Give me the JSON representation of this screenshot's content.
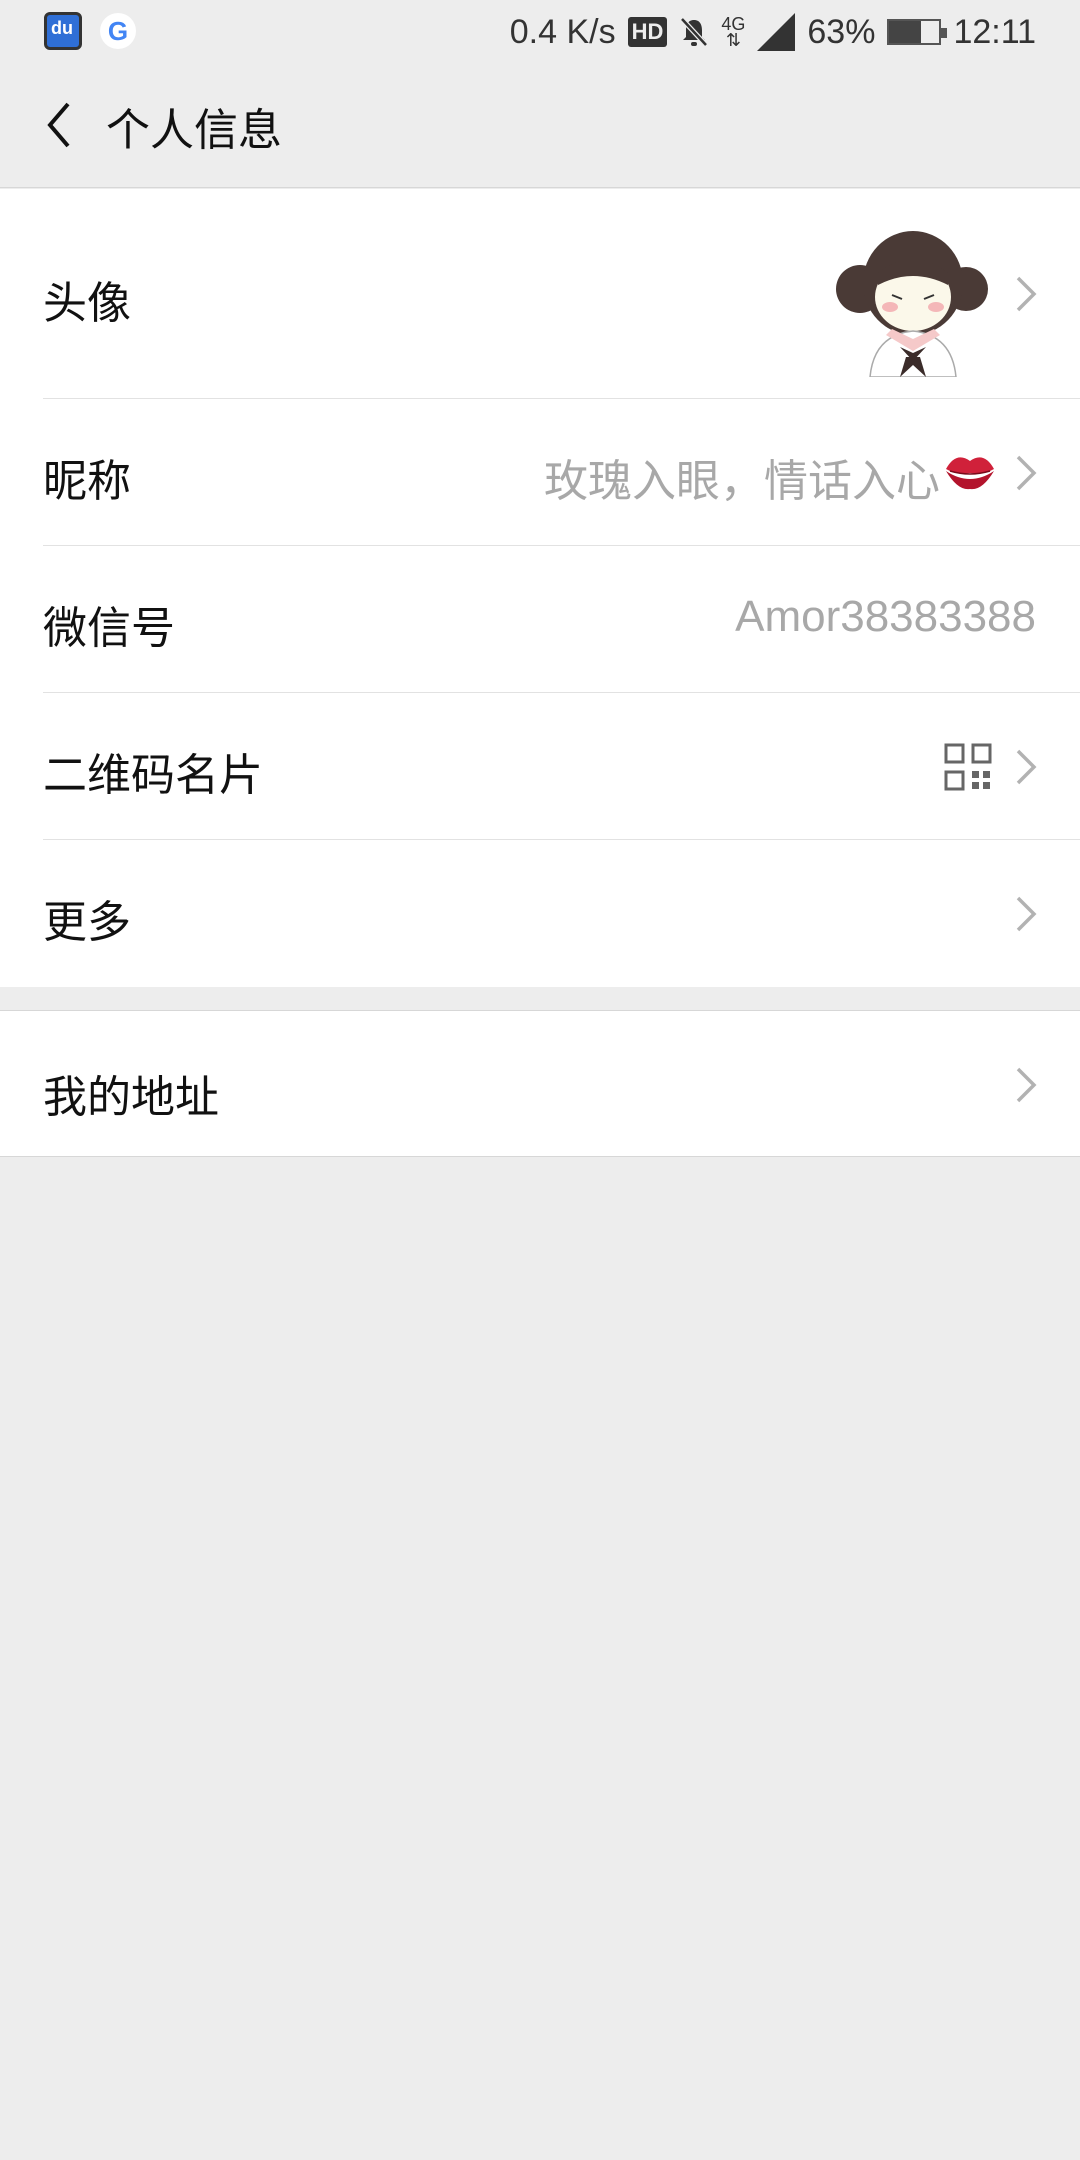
{
  "status_bar": {
    "speed": "0.4 K/s",
    "hd": "HD",
    "network_type": "4G",
    "battery_percent": "63%",
    "battery_level": 0.63,
    "time": "12:11",
    "icons": [
      "du-app-icon",
      "google-icon",
      "hd-icon",
      "mute-bell-icon",
      "network-4g-icon",
      "signal-icon",
      "battery-icon"
    ]
  },
  "nav": {
    "title": "个人信息",
    "back_icon": "chevron-left-icon"
  },
  "profile": {
    "avatar_label": "头像",
    "nickname_label": "昵称",
    "nickname_value": "玫瑰入眼，情话入心",
    "wechat_id_label": "微信号",
    "wechat_id_value": "Amor38383388",
    "qr_label": "二维码名片",
    "more_label": "更多"
  },
  "address": {
    "label": "我的地址"
  },
  "colors": {
    "background": "#ededed",
    "row_background": "#ffffff",
    "secondary_text": "#a8a8a8",
    "chevron": "#b2b2b2"
  }
}
